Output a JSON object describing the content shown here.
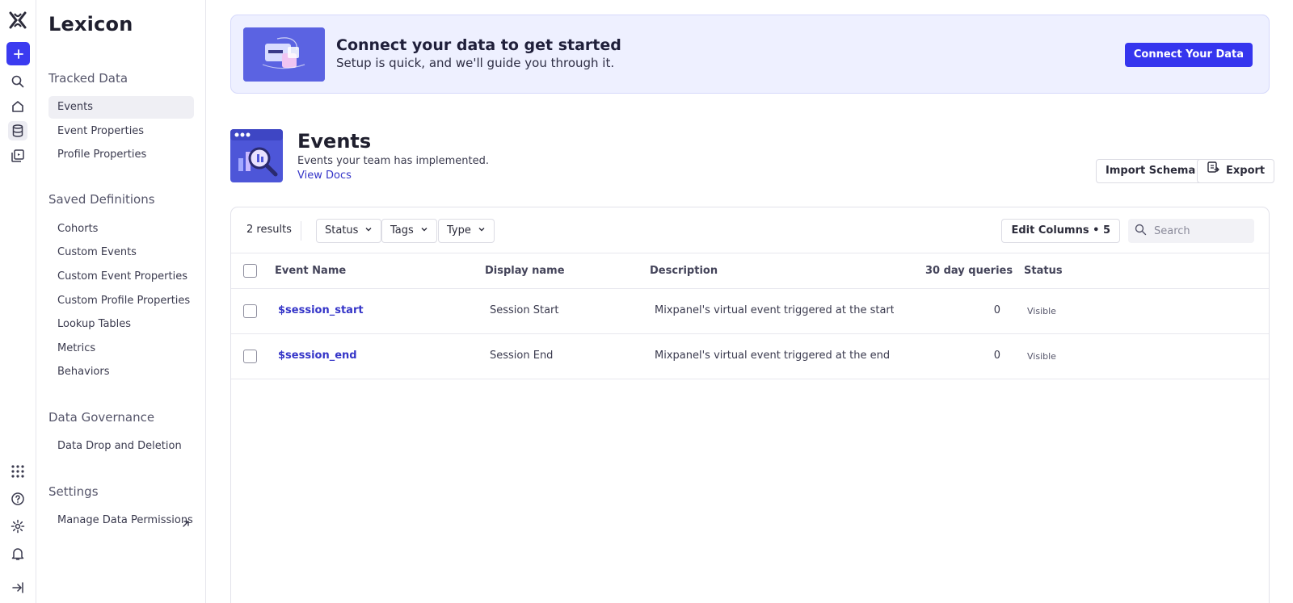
{
  "app": {
    "name": "Lexicon"
  },
  "rail": {
    "icons": [
      "mixpanel-logo-icon",
      "plus-icon",
      "search-icon",
      "home-icon",
      "database-icon",
      "boards-icon",
      "apps-grid-icon",
      "help-icon",
      "settings-icon",
      "bell-icon",
      "collapse-icon"
    ]
  },
  "sidebar": {
    "tracked": {
      "title": "Tracked Data",
      "items": [
        "Events",
        "Event Properties",
        "Profile Properties"
      ]
    },
    "saved": {
      "title": "Saved Definitions",
      "items": [
        "Cohorts",
        "Custom Events",
        "Custom Event Properties",
        "Custom Profile Properties",
        "Lookup Tables",
        "Metrics",
        "Behaviors"
      ]
    },
    "governance": {
      "title": "Data Governance",
      "items": [
        "Data Drop and Deletion"
      ]
    },
    "settings": {
      "title": "Settings",
      "items": [
        "Manage Data Permissions"
      ]
    }
  },
  "banner": {
    "title": "Connect your data to get started",
    "subtitle": "Setup is quick, and we'll guide you through it.",
    "button": "Connect Your Data"
  },
  "page": {
    "title": "Events",
    "subtitle": "Events your team has implemented.",
    "docs_link": "View Docs",
    "import_button": "Import Schema",
    "export_button": "Export"
  },
  "toolbar": {
    "results": "2 results",
    "filters": [
      "Status",
      "Tags",
      "Type"
    ],
    "edit_columns": "Edit Columns • 5",
    "search_placeholder": "Search"
  },
  "table": {
    "headers": [
      "Event Name",
      "Display name",
      "Description",
      "30 day queries",
      "Status"
    ],
    "rows": [
      {
        "event_name": "$session_start",
        "display_name": "Session Start",
        "description": "Mixpanel's virtual event triggered at the start of each session",
        "queries": "0",
        "status": "Visible"
      },
      {
        "event_name": "$session_end",
        "display_name": "Session End",
        "description": "Mixpanel's virtual event triggered at the end of each session",
        "queries": "0",
        "status": "Visible"
      }
    ]
  },
  "colors": {
    "accent": "#3535ee",
    "link": "#3535c8",
    "banner_bg": "#eef0ff"
  }
}
